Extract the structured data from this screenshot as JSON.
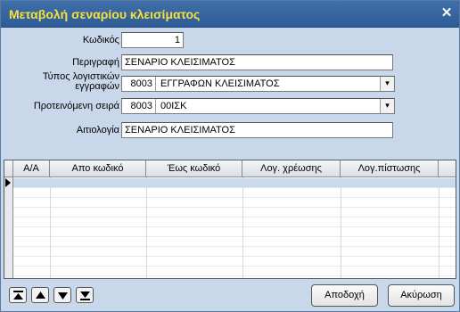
{
  "window": {
    "title": "Μεταβολή σεναρίου κλεισίματος",
    "close_glyph": "✕"
  },
  "form": {
    "code_label": "Κωδικός",
    "code_value": "1",
    "description_label": "Περιγραφή",
    "description_value": "ΣΕΝΑΡΙΟ ΚΛΕΙΣΙΜΑΤΟΣ",
    "doctype_label_line1": "Τύπος λογιστικών",
    "doctype_label_line2": "εγγραφών",
    "doctype_code": "8003",
    "doctype_desc": "ΕΓΓΡΑΦΩΝ ΚΛΕΙΣΙΜΑΤΟΣ",
    "series_label": "Προτεινόμενη σειρά",
    "series_code": "8003",
    "series_desc": "00ΙΣΚ",
    "reason_label": "Αιτιολογία",
    "reason_value": "ΣΕΝΑΡΙΟ ΚΛΕΙΣΙΜΑΤΟΣ",
    "dropdown_glyph": "▾"
  },
  "grid": {
    "columns": [
      "Α/Α",
      "Απο κωδικό",
      "Έως κωδικό",
      "Λογ. χρέωσης",
      "Λογ.πίστωσης"
    ],
    "row_count": 10
  },
  "footer": {
    "nav_buttons": [
      "first-icon",
      "up-icon",
      "down-icon",
      "last-icon"
    ],
    "accept_label": "Αποδοχή",
    "cancel_label": "Ακύρωση"
  },
  "colors": {
    "titlebar": "#3f6ea8",
    "title_text": "#f4e23a",
    "window_bg": "#c8d8ea",
    "selected_row": "#c9d9f0"
  }
}
